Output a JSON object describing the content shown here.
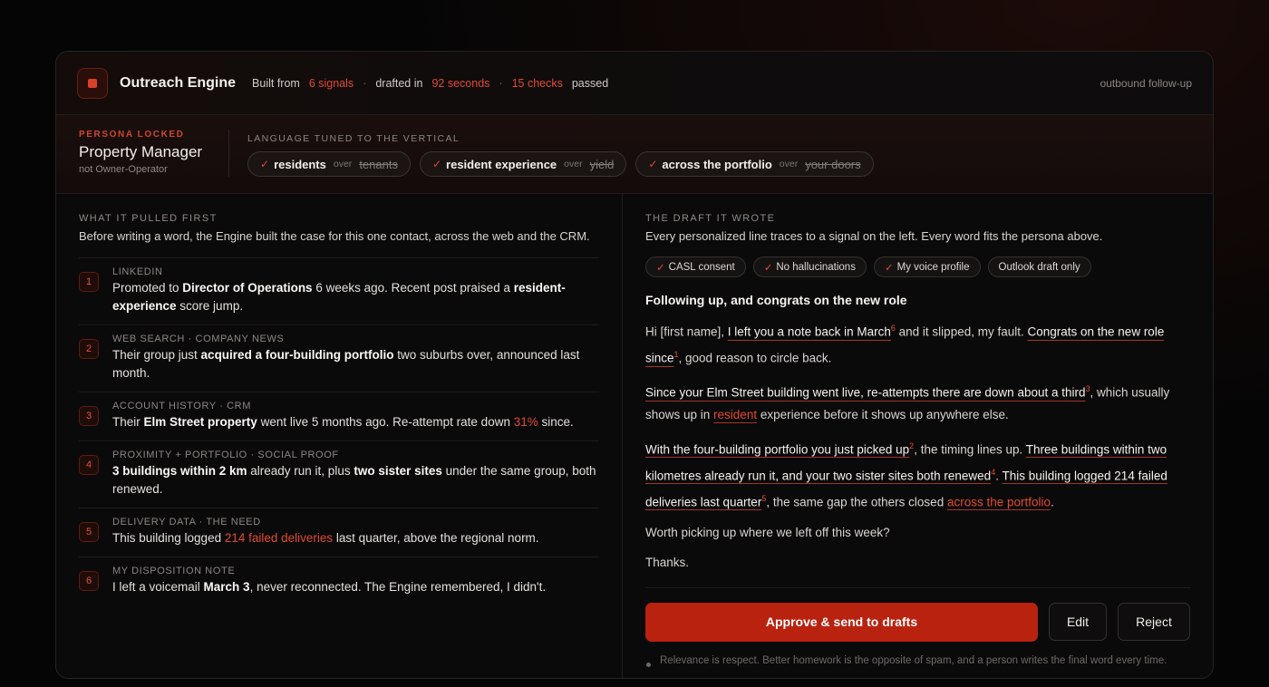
{
  "header": {
    "title": "Outreach Engine",
    "built_from": "Built from",
    "signals": "6 signals",
    "drafted_in": "drafted in",
    "seconds": "92 seconds",
    "checks": "15 checks",
    "passed": "passed",
    "mode": "outbound follow-up"
  },
  "persona": {
    "label": "PERSONA LOCKED",
    "name": "Property Manager",
    "sub": "not Owner-Operator",
    "language_label": "LANGUAGE TUNED TO THE VERTICAL",
    "chips": [
      {
        "word": "residents",
        "over": "over",
        "old": "tenants"
      },
      {
        "word": "resident experience",
        "over": "over",
        "old": "yield"
      },
      {
        "word": "across the portfolio",
        "over": "over",
        "old": "your doors"
      }
    ]
  },
  "left": {
    "label": "WHAT IT PULLED FIRST",
    "desc": "Before writing a word, the Engine built the case for this one contact, across the web and the CRM.",
    "signals": [
      {
        "n": "1",
        "src": "LINKEDIN",
        "t1": "Promoted to ",
        "b1": "Director of Operations",
        "t2": " 6 weeks ago. Recent post praised a ",
        "b2": "resident-experience",
        "t3": " score jump."
      },
      {
        "n": "2",
        "src": "WEB SEARCH · COMPANY NEWS",
        "t1": "Their group just ",
        "b1": "acquired a four-building portfolio",
        "t2": " two suburbs over, announced last month."
      },
      {
        "n": "3",
        "src": "ACCOUNT HISTORY · CRM",
        "t1": "Their ",
        "b1": "Elm Street property",
        "t2": " went live 5 months ago. Re-attempt rate down ",
        "r1": "31%",
        "t3": " since."
      },
      {
        "n": "4",
        "src": "PROXIMITY + PORTFOLIO · SOCIAL PROOF",
        "b1": "3 buildings within 2 km",
        "t1": " already run it, plus ",
        "b2": "two sister sites",
        "t2": " under the same group, both renewed."
      },
      {
        "n": "5",
        "src": "DELIVERY DATA · THE NEED",
        "t1": "This building logged ",
        "r1": "214 failed deliveries",
        "t2": " last quarter, above the regional norm."
      },
      {
        "n": "6",
        "src": "MY DISPOSITION NOTE",
        "t1": "I left a voicemail ",
        "b1": "March 3",
        "t2": ", never reconnected. The Engine remembered, I didn't."
      }
    ]
  },
  "right": {
    "label": "THE DRAFT IT WROTE",
    "desc": "Every personalized line traces to a signal on the left. Every word fits the persona above.",
    "badges": [
      "CASL consent",
      "No hallucinations",
      "My voice profile",
      "Outlook draft only"
    ],
    "subject": "Following up, and congrats on the new role",
    "p1": {
      "a": "Hi [first name], ",
      "u1": "I left you a note back in March",
      "s1": "6",
      "b": " and it slipped, my fault. ",
      "u2": "Congrats on the new role since",
      "s2": "1",
      "c": ", good reason to circle back."
    },
    "p2": {
      "u1": "Since your Elm Street building went live, re-attempts there are down about a third",
      "s1": "3",
      "a": ", which usually shows up in ",
      "r1": "resident",
      "b": " experience before it shows up anywhere else."
    },
    "p3": {
      "u1": "With the four-building portfolio you just picked up",
      "s1": "2",
      "a": ", the timing lines up. ",
      "u2": "Three buildings within two kilometres already run it, and your two sister sites both renewed",
      "s2": "4",
      "b": ". ",
      "u3": "This building logged 214 failed deliveries last quarter",
      "s3": "5",
      "c": ", the same gap the others closed ",
      "r1": "across the portfolio",
      "d": "."
    },
    "p4": "Worth picking up where we left off this week?",
    "p5": "Thanks.",
    "approve": "Approve & send to drafts",
    "edit": "Edit",
    "reject": "Reject",
    "footnote": "Relevance is respect. Better homework is the opposite of spam, and a person writes the final word every time."
  },
  "colors": {
    "accent": "#e04a33",
    "button": "#b8220f",
    "background": "#050505"
  },
  "icons": {
    "check": "check-icon",
    "logo": "stop-square-icon"
  }
}
